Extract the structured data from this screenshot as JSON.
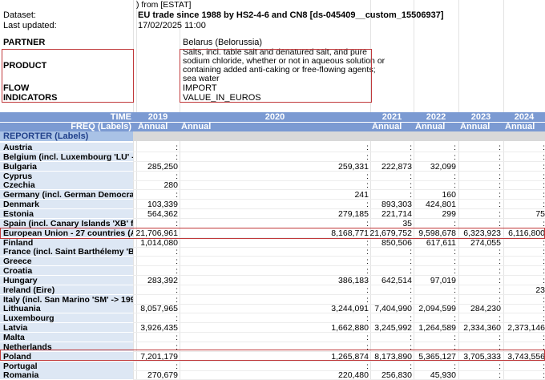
{
  "meta": {
    "source_fragment": ") from [ESTAT]",
    "dataset_label": "Dataset:",
    "dataset_value": "EU trade since 1988 by HS2-4-6 and CN8 [ds-045409__custom_15506937]",
    "last_updated_label": "Last updated:",
    "last_updated_value": "17/02/2025 11:00"
  },
  "filters": {
    "partner_label": "PARTNER",
    "partner_value": "Belarus (Belorussia)",
    "product_label": "PRODUCT",
    "product_value_lines": [
      "Salts, incl. table salt and denatured salt, and pure",
      "sodium chloride, whether or not in aqueous solution or",
      "containing added anti-caking or free-flowing agents;",
      "sea water"
    ],
    "flow_label": "FLOW",
    "flow_value": "IMPORT",
    "indicators_label": "INDICATORS",
    "indicators_value": "VALUE_IN_EUROS"
  },
  "table": {
    "time_label": "TIME",
    "freq_label": "FREQ (Labels)",
    "reporter_label": "REPORTER (Labels)",
    "years": [
      "2019",
      "2020",
      "2021",
      "2022",
      "2023",
      "2024"
    ],
    "freq": [
      "Annual",
      "Annual",
      "Annual",
      "Annual",
      "Annual",
      "Annual"
    ],
    "rows": [
      {
        "name": "Austria",
        "v": [
          ":",
          ":",
          ":",
          ":",
          ":",
          ":"
        ]
      },
      {
        "name": "Belgium (incl. Luxembourg 'LU' -> 1",
        "v": [
          ":",
          ":",
          ":",
          ":",
          ":",
          ":"
        ]
      },
      {
        "name": "Bulgaria",
        "v": [
          "285,250",
          "259,331",
          "222,873",
          "32,099",
          ":",
          ":"
        ]
      },
      {
        "name": "Cyprus",
        "v": [
          ":",
          ":",
          ":",
          ":",
          ":",
          ":"
        ]
      },
      {
        "name": "Czechia",
        "v": [
          "280",
          ":",
          ":",
          ":",
          ":",
          ":"
        ]
      },
      {
        "name": "Germany (incl. German Democratic",
        "v": [
          ":",
          "241",
          ":",
          "160",
          ":",
          ":"
        ]
      },
      {
        "name": "Denmark",
        "v": [
          "103,339",
          ":",
          "893,303",
          "424,801",
          ":",
          ":"
        ]
      },
      {
        "name": "Estonia",
        "v": [
          "564,362",
          "279,185",
          "221,714",
          "299",
          ":",
          "75"
        ]
      },
      {
        "name": "Spain (incl. Canary Islands 'XB' from",
        "v": [
          ":",
          ":",
          "35",
          ":",
          ":",
          ":"
        ]
      },
      {
        "name": "European Union - 27 countries (AT, B",
        "v": [
          "21,706,961",
          "8,168,771",
          "21,679,752",
          "9,598,678",
          "6,323,923",
          "6,116,800"
        ]
      },
      {
        "name": "Finland",
        "v": [
          "1,014,080",
          ":",
          "850,506",
          "617,611",
          "274,055",
          ":"
        ]
      },
      {
        "name": "France (incl. Saint Barthélemy 'BL' -",
        "v": [
          ":",
          ":",
          ":",
          ":",
          ":",
          ":"
        ]
      },
      {
        "name": "Greece",
        "v": [
          ":",
          ":",
          ":",
          ":",
          ":",
          ":"
        ]
      },
      {
        "name": "Croatia",
        "v": [
          ":",
          ":",
          ":",
          ":",
          ":",
          ":"
        ]
      },
      {
        "name": "Hungary",
        "v": [
          "283,392",
          "386,183",
          "642,514",
          "97,019",
          ":",
          ":"
        ]
      },
      {
        "name": "Ireland (Eire)",
        "v": [
          ":",
          ":",
          ":",
          ":",
          ":",
          "23"
        ]
      },
      {
        "name": "Italy (incl. San Marino 'SM' -> 1993)",
        "v": [
          ":",
          ":",
          ":",
          ":",
          ":",
          ":"
        ]
      },
      {
        "name": "Lithuania",
        "v": [
          "8,057,965",
          "3,244,091",
          "7,404,990",
          "2,094,599",
          "284,230",
          ":"
        ]
      },
      {
        "name": "Luxembourg",
        "v": [
          ":",
          ":",
          ":",
          ":",
          ":",
          ":"
        ]
      },
      {
        "name": "Latvia",
        "v": [
          "3,926,435",
          "1,662,880",
          "3,245,992",
          "1,264,589",
          "2,334,360",
          "2,373,146"
        ]
      },
      {
        "name": "Malta",
        "v": [
          ":",
          ":",
          ":",
          ":",
          ":",
          ":"
        ]
      },
      {
        "name": "Netherlands",
        "v": [
          ":",
          ":",
          ":",
          ":",
          ":",
          ":"
        ]
      },
      {
        "name": "Poland",
        "v": [
          "7,201,179",
          "1,265,874",
          "8,173,890",
          "5,365,127",
          "3,705,333",
          "3,743,556"
        ]
      },
      {
        "name": "Portugal",
        "v": [
          ":",
          ":",
          ":",
          ":",
          ":",
          ":"
        ]
      },
      {
        "name": "Romania",
        "v": [
          "270,679",
          "220,480",
          "256,830",
          "45,930",
          ":",
          ":"
        ]
      }
    ]
  }
}
